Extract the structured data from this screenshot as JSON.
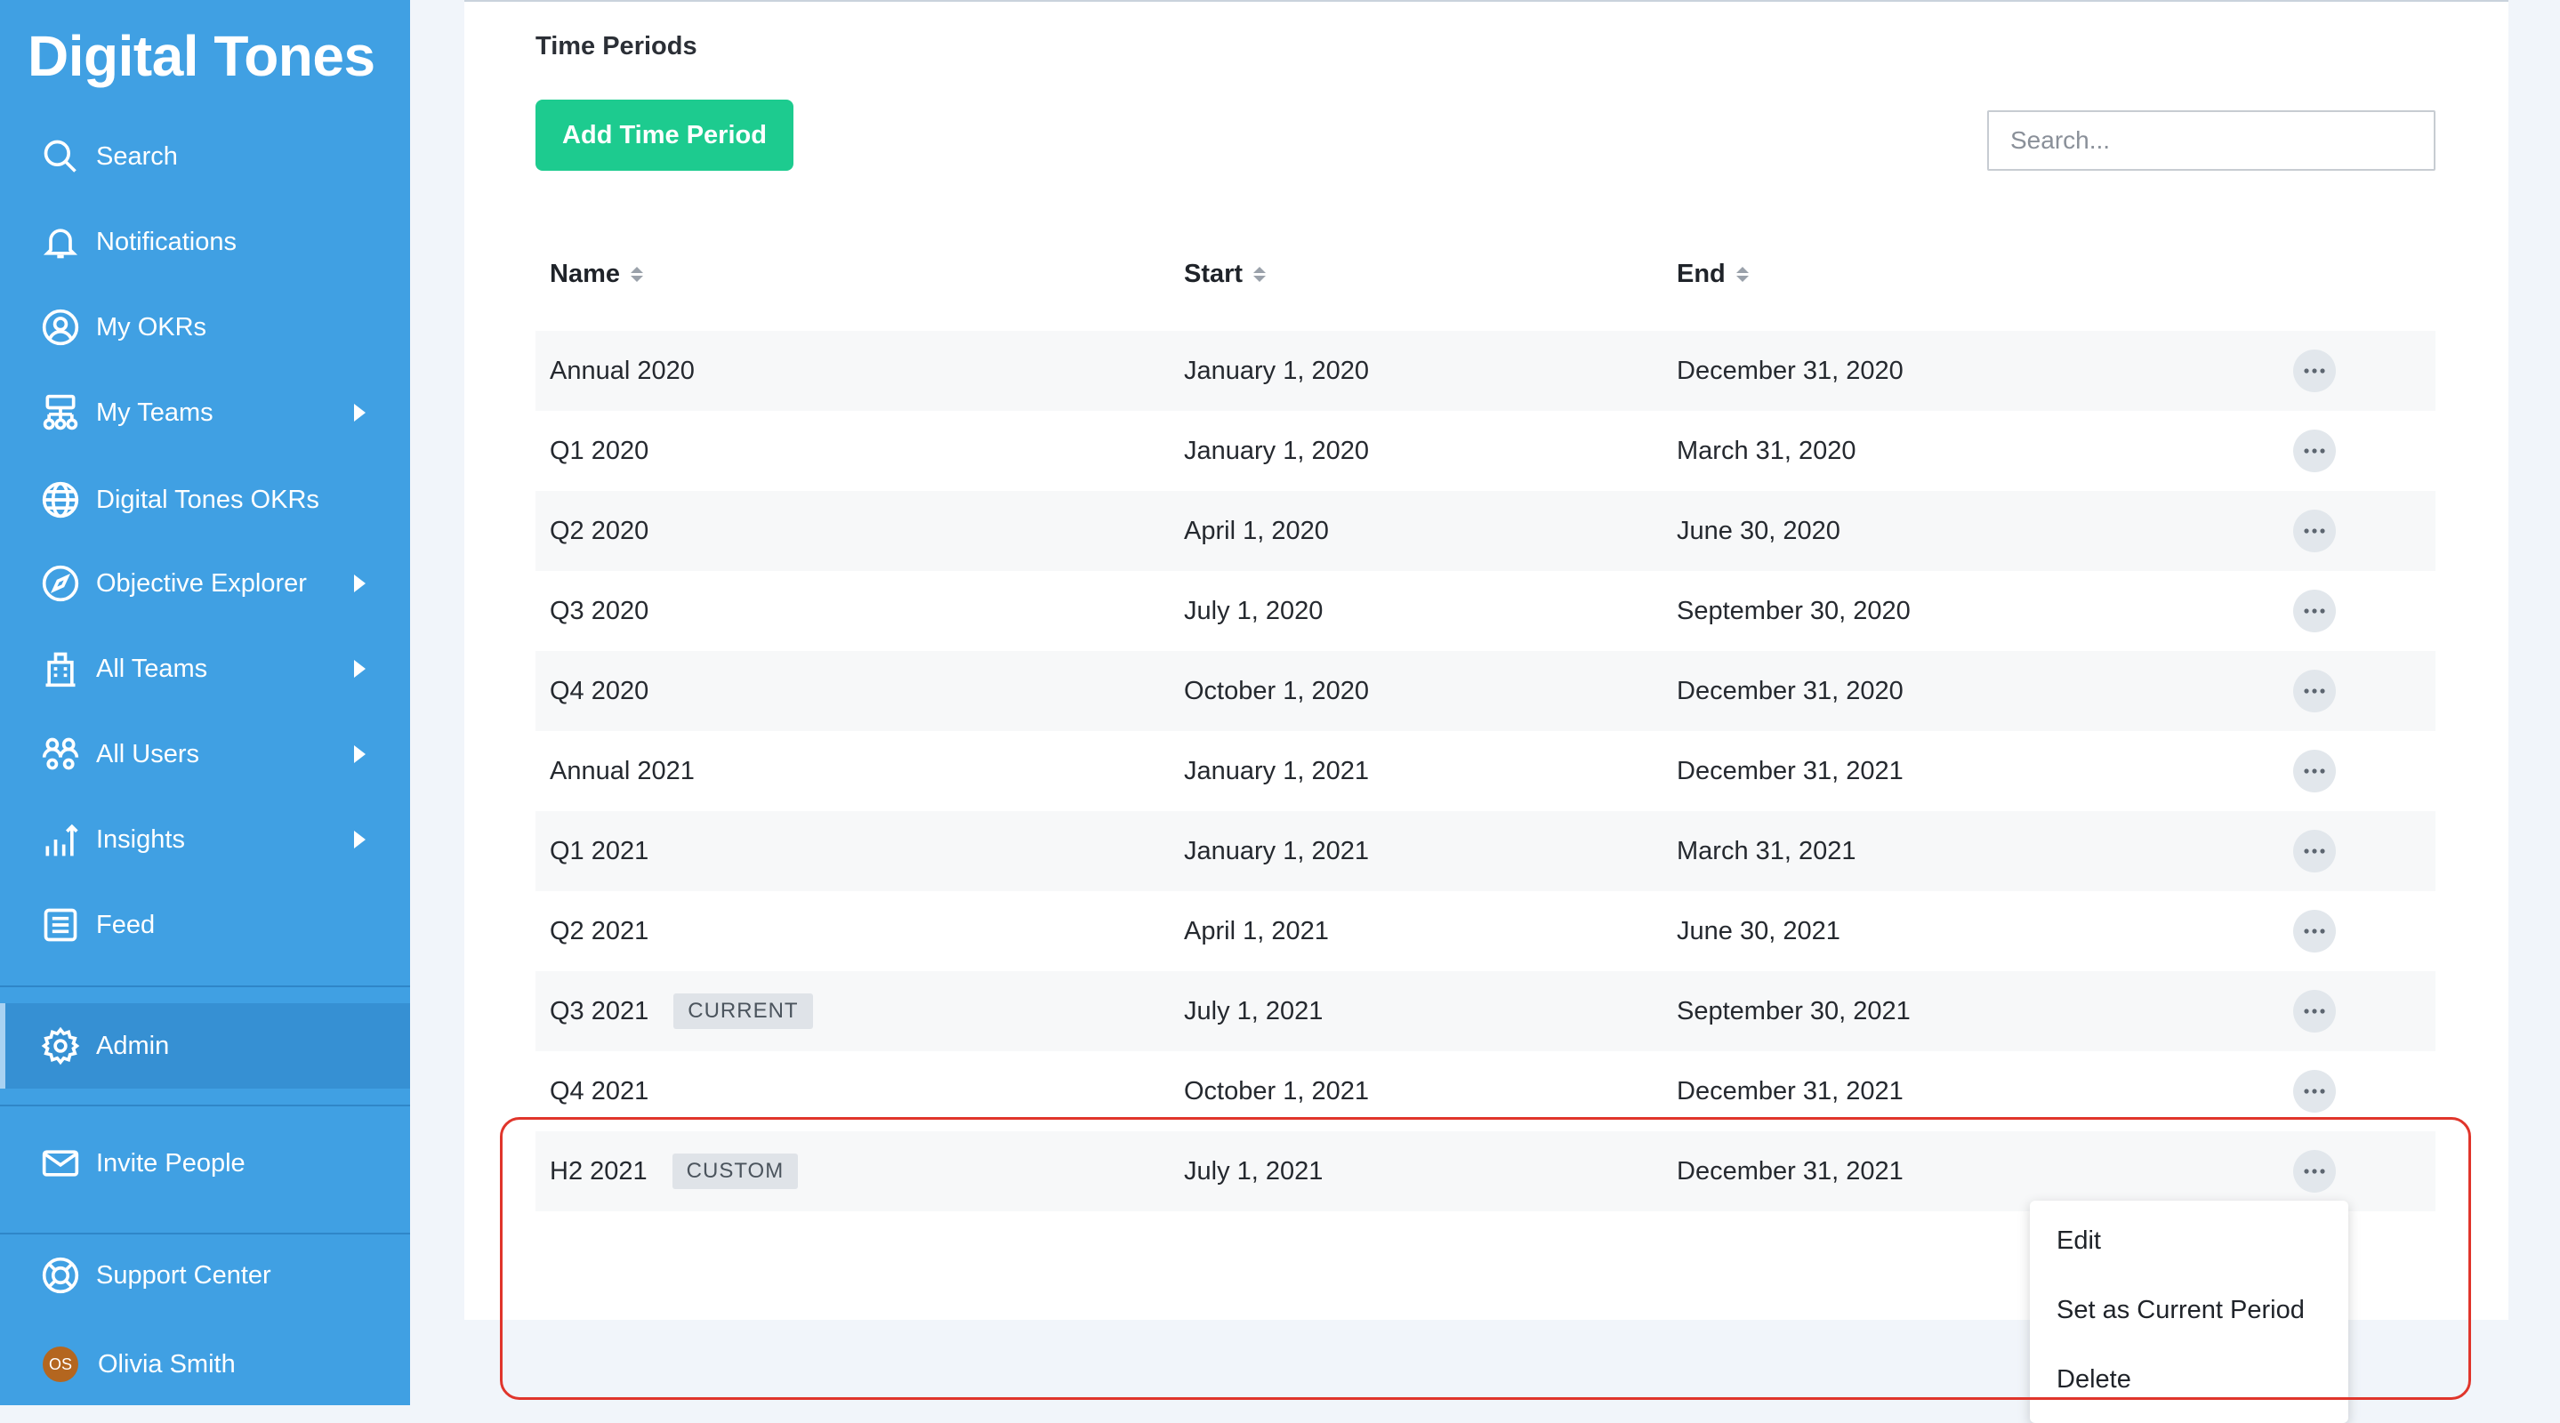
{
  "brand": "Digital Tones",
  "sidebar": {
    "items": [
      {
        "label": "Search",
        "icon": "search-icon"
      },
      {
        "label": "Notifications",
        "icon": "bell-icon"
      },
      {
        "label": "My OKRs",
        "icon": "user-circle-icon"
      },
      {
        "label": "My Teams",
        "icon": "org-chart-icon"
      },
      {
        "label": "Digital Tones OKRs",
        "icon": "globe-icon"
      },
      {
        "label": "Objective Explorer",
        "icon": "compass-icon"
      },
      {
        "label": "All Teams",
        "icon": "building-icon"
      },
      {
        "label": "All Users",
        "icon": "users-icon"
      },
      {
        "label": "Insights",
        "icon": "chart-icon"
      },
      {
        "label": "Feed",
        "icon": "list-icon"
      }
    ],
    "admin": {
      "label": "Admin",
      "icon": "gear-icon"
    },
    "invite": {
      "label": "Invite People",
      "icon": "envelope-icon"
    },
    "support": {
      "label": "Support Center",
      "icon": "lifebuoy-icon"
    },
    "user": {
      "initials": "OS",
      "name": "Olivia Smith"
    }
  },
  "main": {
    "title": "Time Periods",
    "add_button": "Add Time Period",
    "search_placeholder": "Search...",
    "columns": {
      "name": "Name",
      "start": "Start",
      "end": "End"
    },
    "rows": [
      {
        "name": "Annual 2020",
        "start": "January 1, 2020",
        "end": "December 31, 2020",
        "badge": ""
      },
      {
        "name": "Q1 2020",
        "start": "January 1, 2020",
        "end": "March 31, 2020",
        "badge": ""
      },
      {
        "name": "Q2 2020",
        "start": "April 1, 2020",
        "end": "June 30, 2020",
        "badge": ""
      },
      {
        "name": "Q3 2020",
        "start": "July 1, 2020",
        "end": "September 30, 2020",
        "badge": ""
      },
      {
        "name": "Q4 2020",
        "start": "October 1, 2020",
        "end": "December 31, 2020",
        "badge": ""
      },
      {
        "name": "Annual 2021",
        "start": "January 1, 2021",
        "end": "December 31, 2021",
        "badge": ""
      },
      {
        "name": "Q1 2021",
        "start": "January 1, 2021",
        "end": "March 31, 2021",
        "badge": ""
      },
      {
        "name": "Q2 2021",
        "start": "April 1, 2021",
        "end": "June 30, 2021",
        "badge": ""
      },
      {
        "name": "Q3 2021",
        "start": "July 1, 2021",
        "end": "September 30, 2021",
        "badge": "CURRENT"
      },
      {
        "name": "Q4 2021",
        "start": "October 1, 2021",
        "end": "December 31, 2021",
        "badge": ""
      },
      {
        "name": "H2 2021",
        "start": "July 1, 2021",
        "end": "December 31, 2021",
        "badge": "CUSTOM"
      }
    ]
  },
  "menu": {
    "items": [
      "Edit",
      "Set as Current Period",
      "Delete"
    ]
  },
  "colors": {
    "sidebar": "#40a0e3",
    "accent_button": "#1dcb8f",
    "highlight_border": "#e0352b"
  }
}
